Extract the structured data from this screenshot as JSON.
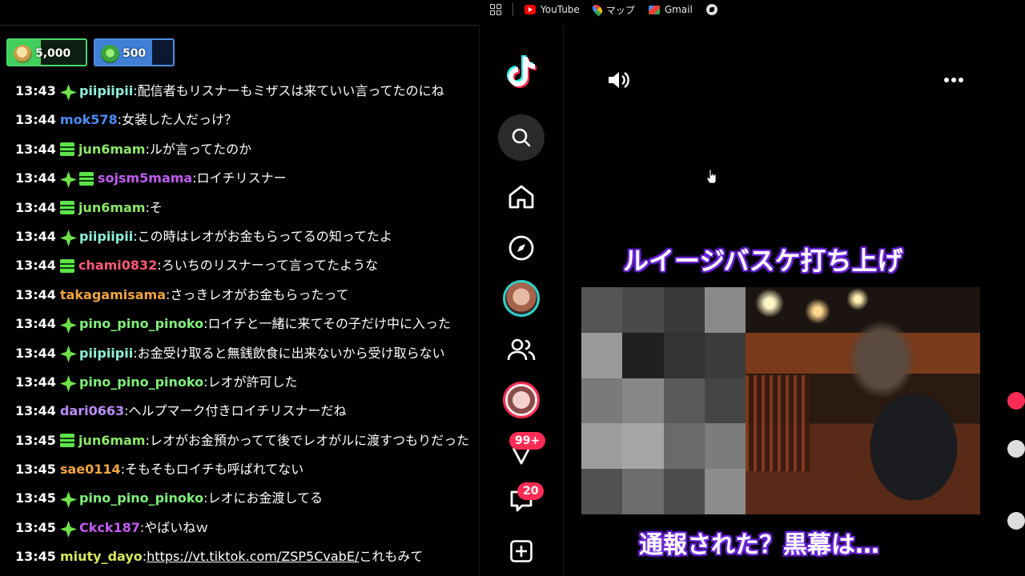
{
  "chat": {
    "goals": [
      {
        "value": "5,000",
        "fill": 0.42
      },
      {
        "value": "500",
        "fill": 0.73
      }
    ],
    "messages": [
      {
        "time": "13:43",
        "badges": [
          "diamond"
        ],
        "user": "piipiipii",
        "color": "#8ff0d8",
        "text": "配信者もリスナーもミザスは来ていい言ってたのにね"
      },
      {
        "time": "13:44",
        "badges": [],
        "user": "mok578",
        "color": "#4b8df8",
        "text": "女装した人だっけ？"
      },
      {
        "time": "13:44",
        "badges": [
          "gift"
        ],
        "user": "jun6mam",
        "color": "#8de96a",
        "text": "ルが言ってたのか"
      },
      {
        "time": "13:44",
        "badges": [
          "diamond",
          "gift"
        ],
        "user": "sojsm5mama",
        "color": "#c05cf0",
        "text": "ロイチリスナー"
      },
      {
        "time": "13:44",
        "badges": [
          "gift"
        ],
        "user": "jun6mam",
        "color": "#8de96a",
        "text": "そ"
      },
      {
        "time": "13:44",
        "badges": [
          "diamond"
        ],
        "user": "piipiipii",
        "color": "#8ff0d8",
        "text": "この時はレオがお金もらってるの知ってたよ"
      },
      {
        "time": "13:44",
        "badges": [
          "gift"
        ],
        "user": "chami0832",
        "color": "#ff5a7a",
        "text": "ろいちのリスナーって言ってたような"
      },
      {
        "time": "13:44",
        "badges": [],
        "user": "takagamisama",
        "color": "#f0a640",
        "text": "さっきレオがお金もらったって"
      },
      {
        "time": "13:44",
        "badges": [
          "diamond"
        ],
        "user": "pino_pino_pinoko",
        "color": "#7ff07a",
        "text": "ロイチと一緒に来てその子だけ中に入った"
      },
      {
        "time": "13:44",
        "badges": [
          "diamond"
        ],
        "user": "piipiipii",
        "color": "#8ff0d8",
        "text": "お金受け取ると無銭飲食に出来ないから受け取らない"
      },
      {
        "time": "13:44",
        "badges": [
          "diamond"
        ],
        "user": "pino_pino_pinoko",
        "color": "#7ff07a",
        "text": "レオが許可した"
      },
      {
        "time": "13:44",
        "badges": [],
        "user": "dari0663",
        "color": "#b98cf8",
        "text": "ヘルプマーク付きロイチリスナーだね"
      },
      {
        "time": "13:45",
        "badges": [
          "gift"
        ],
        "user": "jun6mam",
        "color": "#8de96a",
        "text": "レオがお金預かってて後でレオがルに渡すつもりだった"
      },
      {
        "time": "13:45",
        "badges": [],
        "user": "sae0114",
        "color": "#f0a640",
        "text": "そもそもロイチも呼ばれてない"
      },
      {
        "time": "13:45",
        "badges": [
          "diamond"
        ],
        "user": "pino_pino_pinoko",
        "color": "#7ff07a",
        "text": "レオにお金渡してる"
      },
      {
        "time": "13:45",
        "badges": [
          "diamond"
        ],
        "user": "Ckck187",
        "color": "#c05cf0",
        "text": "やばいねｗ"
      },
      {
        "time": "13:45",
        "badges": [],
        "user": "miuty_dayo",
        "color": "#d7e65a",
        "text": "",
        "link": "https://vt.tiktok.com/ZSP5CvabE/",
        "after": "これもみて"
      }
    ]
  },
  "bookmarks": {
    "items": [
      {
        "label": "YouTube",
        "icon": "youtube-icon"
      },
      {
        "label": "マップ",
        "icon": "maps-icon"
      },
      {
        "label": "Gmail",
        "icon": "gmail-icon"
      }
    ]
  },
  "tiktok": {
    "sidebar": {
      "notifications_badge": "99+",
      "messages_badge": "20"
    },
    "video": {
      "caption_top": "ルイージバスケ打ち上げ",
      "caption_bottom": "通報された？黒幕は…"
    }
  },
  "colors": {
    "accent": "#fe2c55",
    "tiktok_cyan": "#25f4ee"
  }
}
